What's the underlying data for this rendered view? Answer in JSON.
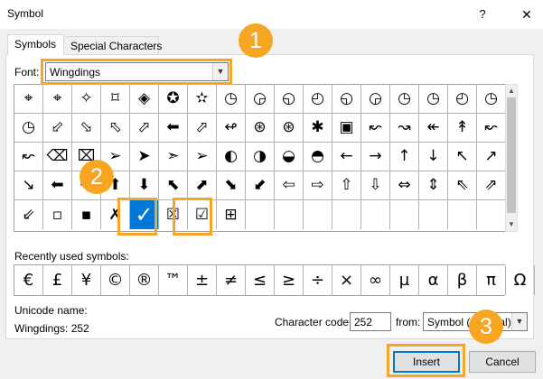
{
  "window": {
    "title": "Symbol",
    "help_label": "?",
    "close_label": "✕"
  },
  "tabs": [
    {
      "label": "Symbols",
      "active": true
    },
    {
      "label": "Special Characters",
      "active": false
    }
  ],
  "font": {
    "label": "Font:",
    "value": "Wingdings"
  },
  "symbol_grid": [
    [
      "⌖",
      "⌖",
      "✧",
      "⌑",
      "◈",
      "✪",
      "✫",
      "◷",
      "◶",
      "◵",
      "◴",
      "◵",
      "◶",
      "◷",
      "◷",
      "◴",
      "◷"
    ],
    [
      "◷",
      "⬃",
      "⬂",
      "⬁",
      "⬀",
      "⬅",
      "⬀",
      "↫",
      "⊛",
      "⊛",
      "✱",
      "▣",
      "↜",
      "↝",
      "↞",
      "↟",
      "↜"
    ],
    [
      "↜",
      "⌫",
      "⌧",
      "➢",
      "➤",
      "➣",
      "➢",
      "◐",
      "◑",
      "◒",
      "◓",
      "←",
      "→",
      "↑",
      "↓",
      "↖",
      "↗"
    ],
    [
      "↘",
      "⬅",
      "➔",
      "⬆",
      "⬇",
      "⬉",
      "⬈",
      "⬊",
      "⬋",
      "⇦",
      "⇨",
      "⇧",
      "⇩",
      "⇔",
      "⇕",
      "⇖",
      "⇗"
    ],
    [
      "⇙",
      "▫",
      "▪",
      "✗",
      "✓",
      "☒",
      "☑",
      "⊞",
      "",
      "",
      "",
      "",
      "",
      "",
      "",
      "",
      ""
    ]
  ],
  "selected_symbol": {
    "glyph": "✓"
  },
  "recent": {
    "label": "Recently used symbols:",
    "symbols": [
      "€",
      "£",
      "¥",
      "©",
      "®",
      "™",
      "±",
      "≠",
      "≤",
      "≥",
      "÷",
      "×",
      "∞",
      "µ",
      "α",
      "β",
      "π",
      "Ω"
    ]
  },
  "unicode": {
    "label": "Unicode name:",
    "value": "Wingdings: 252"
  },
  "character_code": {
    "label": "Character code:",
    "value": "252"
  },
  "from": {
    "label": "from:",
    "value": "Symbol (decimal)"
  },
  "buttons": {
    "insert": "Insert",
    "cancel": "Cancel"
  },
  "annotations": [
    "1",
    "2",
    "3"
  ],
  "colors": {
    "highlight": "#f6a623",
    "selection": "#0078d7"
  }
}
